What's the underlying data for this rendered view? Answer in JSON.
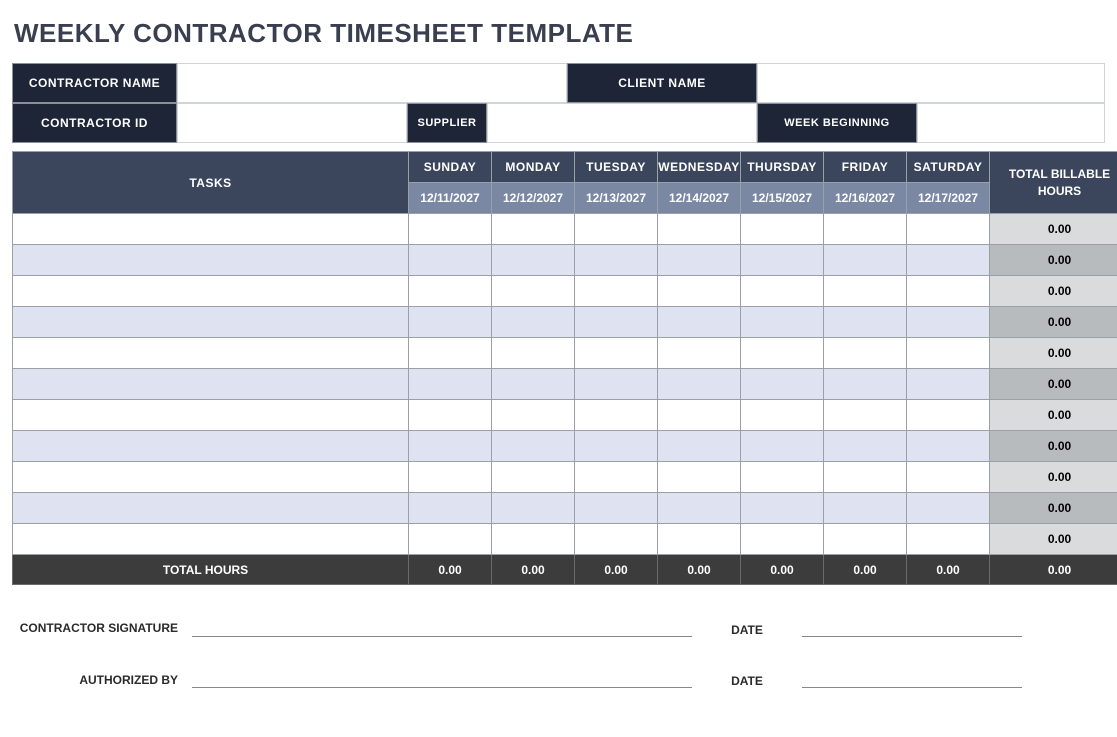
{
  "title": "WEEKLY CONTRACTOR TIMESHEET TEMPLATE",
  "header": {
    "contractor_name_label": "CONTRACTOR NAME",
    "contractor_name_value": "",
    "client_name_label": "CLIENT NAME",
    "client_name_value": "",
    "contractor_id_label": "CONTRACTOR ID",
    "contractor_id_value": "",
    "supplier_label": "SUPPLIER",
    "supplier_value": "",
    "week_beginning_label": "WEEK BEGINNING",
    "week_beginning_value": ""
  },
  "table": {
    "tasks_label": "TASKS",
    "total_billable_label": "TOTAL BILLABLE HOURS",
    "days": [
      {
        "name": "SUNDAY",
        "date": "12/11/2027"
      },
      {
        "name": "MONDAY",
        "date": "12/12/2027"
      },
      {
        "name": "TUESDAY",
        "date": "12/13/2027"
      },
      {
        "name": "WEDNESDAY",
        "date": "12/14/2027"
      },
      {
        "name": "THURSDAY",
        "date": "12/15/2027"
      },
      {
        "name": "FRIDAY",
        "date": "12/16/2027"
      },
      {
        "name": "SATURDAY",
        "date": "12/17/2027"
      }
    ],
    "rows": [
      {
        "task": "",
        "hours": [
          "",
          "",
          "",
          "",
          "",
          "",
          ""
        ],
        "total": "0.00"
      },
      {
        "task": "",
        "hours": [
          "",
          "",
          "",
          "",
          "",
          "",
          ""
        ],
        "total": "0.00"
      },
      {
        "task": "",
        "hours": [
          "",
          "",
          "",
          "",
          "",
          "",
          ""
        ],
        "total": "0.00"
      },
      {
        "task": "",
        "hours": [
          "",
          "",
          "",
          "",
          "",
          "",
          ""
        ],
        "total": "0.00"
      },
      {
        "task": "",
        "hours": [
          "",
          "",
          "",
          "",
          "",
          "",
          ""
        ],
        "total": "0.00"
      },
      {
        "task": "",
        "hours": [
          "",
          "",
          "",
          "",
          "",
          "",
          ""
        ],
        "total": "0.00"
      },
      {
        "task": "",
        "hours": [
          "",
          "",
          "",
          "",
          "",
          "",
          ""
        ],
        "total": "0.00"
      },
      {
        "task": "",
        "hours": [
          "",
          "",
          "",
          "",
          "",
          "",
          ""
        ],
        "total": "0.00"
      },
      {
        "task": "",
        "hours": [
          "",
          "",
          "",
          "",
          "",
          "",
          ""
        ],
        "total": "0.00"
      },
      {
        "task": "",
        "hours": [
          "",
          "",
          "",
          "",
          "",
          "",
          ""
        ],
        "total": "0.00"
      },
      {
        "task": "",
        "hours": [
          "",
          "",
          "",
          "",
          "",
          "",
          ""
        ],
        "total": "0.00"
      }
    ],
    "total_hours_label": "TOTAL HOURS",
    "day_totals": [
      "0.00",
      "0.00",
      "0.00",
      "0.00",
      "0.00",
      "0.00",
      "0.00"
    ],
    "grand_total": "0.00"
  },
  "signatures": {
    "contractor_signature_label": "CONTRACTOR SIGNATURE",
    "authorized_by_label": "AUTHORIZED BY",
    "date_label": "DATE"
  }
}
